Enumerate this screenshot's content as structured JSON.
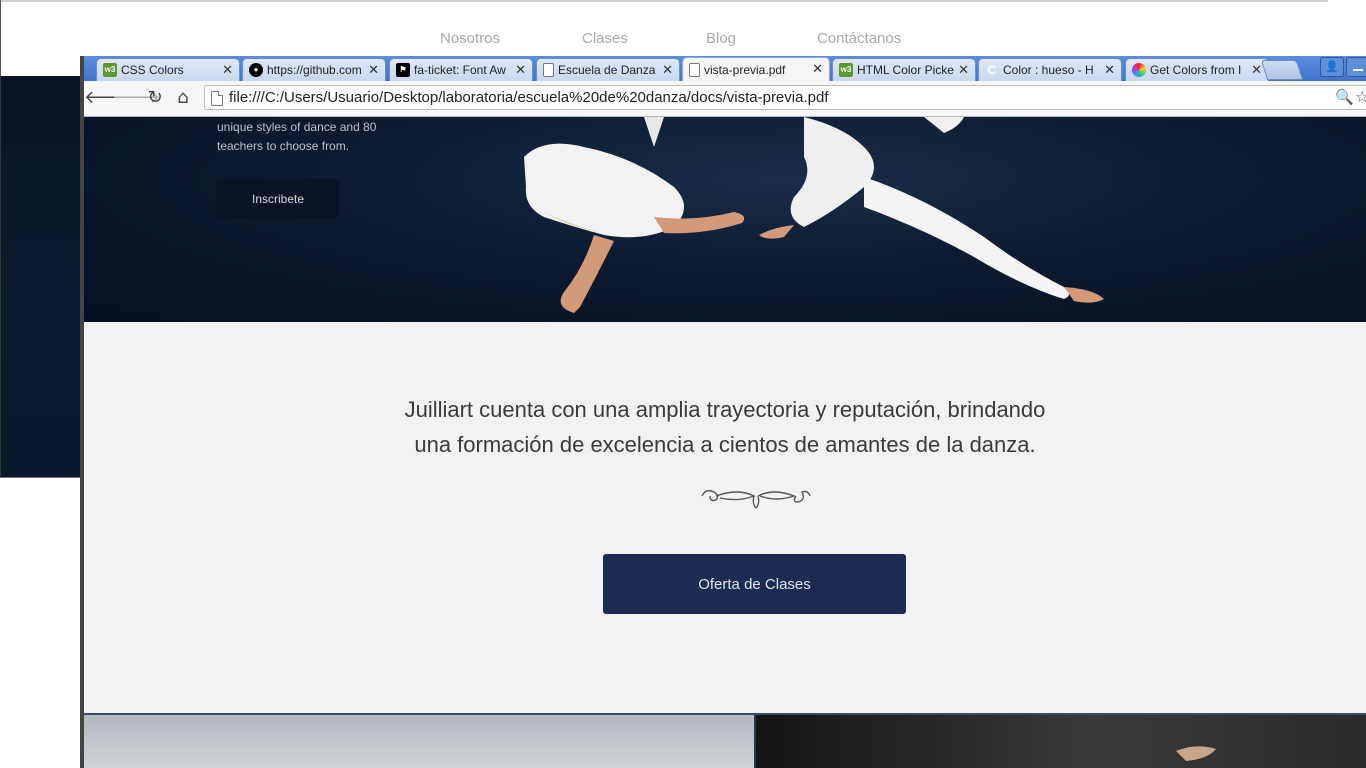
{
  "outer_page": {
    "nav": [
      "Nosotros",
      "Clases",
      "Blog",
      "Contáctanos"
    ]
  },
  "browser": {
    "tabs": [
      {
        "label": "CSS Colors",
        "icon": "w3-icon",
        "color": "#5a9a2a",
        "active": false
      },
      {
        "label": "https://github.com",
        "icon": "github-icon",
        "color": "#000000",
        "active": false
      },
      {
        "label": "fa-ticket: Font Aw",
        "icon": "fontawesome-flag-icon",
        "color": "#000000",
        "active": false
      },
      {
        "label": "Escuela de Danza",
        "icon": "page-icon",
        "color": "#777777",
        "active": false
      },
      {
        "label": "vista-previa.pdf",
        "icon": "page-icon",
        "color": "#777777",
        "active": true
      },
      {
        "label": "HTML Color Picke",
        "icon": "w3-icon",
        "color": "#5a9a2a",
        "active": false
      },
      {
        "label": "Color : hueso - H",
        "icon": "loading-icon",
        "color": "#ffffff",
        "active": false
      },
      {
        "label": "Get Colors from I",
        "icon": "color-wheel-icon",
        "color": "#e23",
        "active": false
      }
    ],
    "url": "file:///C:/Users/Usuario/Desktop/laboratoria/escuela%20de%20danza/docs/vista-previa.pdf"
  },
  "hero": {
    "text": "unique styles of dance and 80 teachers to choose from.",
    "button": "Inscribete"
  },
  "about": {
    "line1": "Juilliart cuenta con una amplia trayectoria y reputación, brindando",
    "line2": "una formación de excelencia a cientos de amantes de la danza.",
    "button": "Oferta de Clases"
  },
  "colors": {
    "navy_button": "#1c2b52",
    "hero_bg": "#0d1a30",
    "about_bg": "#f2f2f2"
  }
}
